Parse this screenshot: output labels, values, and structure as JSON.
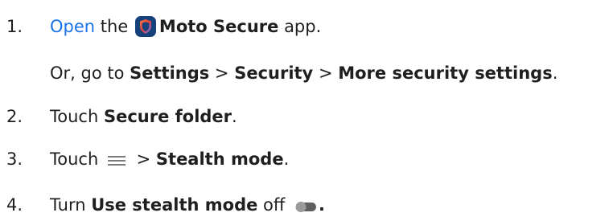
{
  "steps": [
    {
      "number": "1.",
      "link": "Open",
      "text_the": " the ",
      "app_name": "Moto Secure",
      "text_app": " app.",
      "app_icon": "moto-secure-shield-icon"
    },
    {
      "text_or": "Or, go to ",
      "settings": "Settings",
      "sep1": " > ",
      "security": "Security",
      "sep2": " > ",
      "more": "More security settings",
      "end": "."
    },
    {
      "number": "2.",
      "text_touch": "Touch ",
      "target": "Secure folder",
      "end": "."
    },
    {
      "number": "3.",
      "text_touch": "Touch ",
      "menu_icon": "menu-icon",
      "sep": " > ",
      "target": "Stealth mode",
      "end": "."
    },
    {
      "number": "4.",
      "text_turn": "Turn ",
      "target": "Use stealth mode",
      "text_off": " off ",
      "toggle_icon": "toggle-off-icon",
      "end": "."
    }
  ],
  "colors": {
    "link": "#1a73e8",
    "text": "#1f1f1f",
    "app_icon_bg": "#15427a",
    "toggle": "#7a7a7a"
  }
}
